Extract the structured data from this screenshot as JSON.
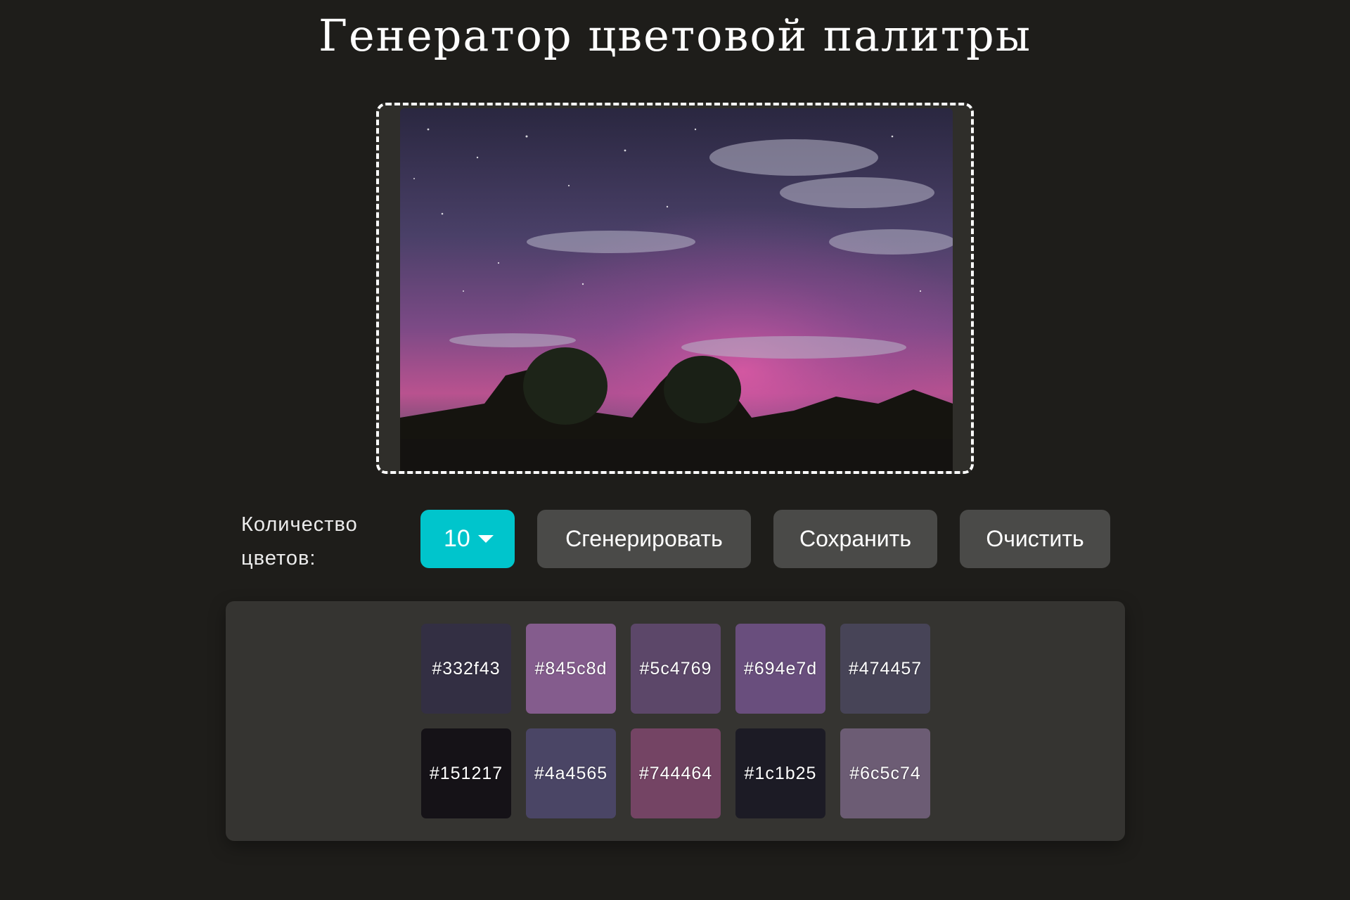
{
  "page": {
    "title": "Генератор цветовой палитры",
    "background_color": "#1e1d1a"
  },
  "dropzone": {
    "border_color": "#ffffff",
    "image_description_icon": "night-sky-photo"
  },
  "controls": {
    "count_label": "Количество цветов:",
    "count_value": "10",
    "count_accent_color": "#00c5cc",
    "generate_label": "Сгенерировать",
    "save_label": "Сохранить",
    "clear_label": "Очистить"
  },
  "palette": {
    "swatches": [
      {
        "hex": "#332f43",
        "label": "#332f43"
      },
      {
        "hex": "#845c8d",
        "label": "#845c8d"
      },
      {
        "hex": "#5c4769",
        "label": "#5c4769"
      },
      {
        "hex": "#694e7d",
        "label": "#694e7d"
      },
      {
        "hex": "#474457",
        "label": "#474457"
      },
      {
        "hex": "#151217",
        "label": "#151217"
      },
      {
        "hex": "#4a4565",
        "label": "#4a4565"
      },
      {
        "hex": "#744464",
        "label": "#744464"
      },
      {
        "hex": "#1c1b25",
        "label": "#1c1b25"
      },
      {
        "hex": "#6c5c74",
        "label": "#6c5c74"
      }
    ]
  }
}
